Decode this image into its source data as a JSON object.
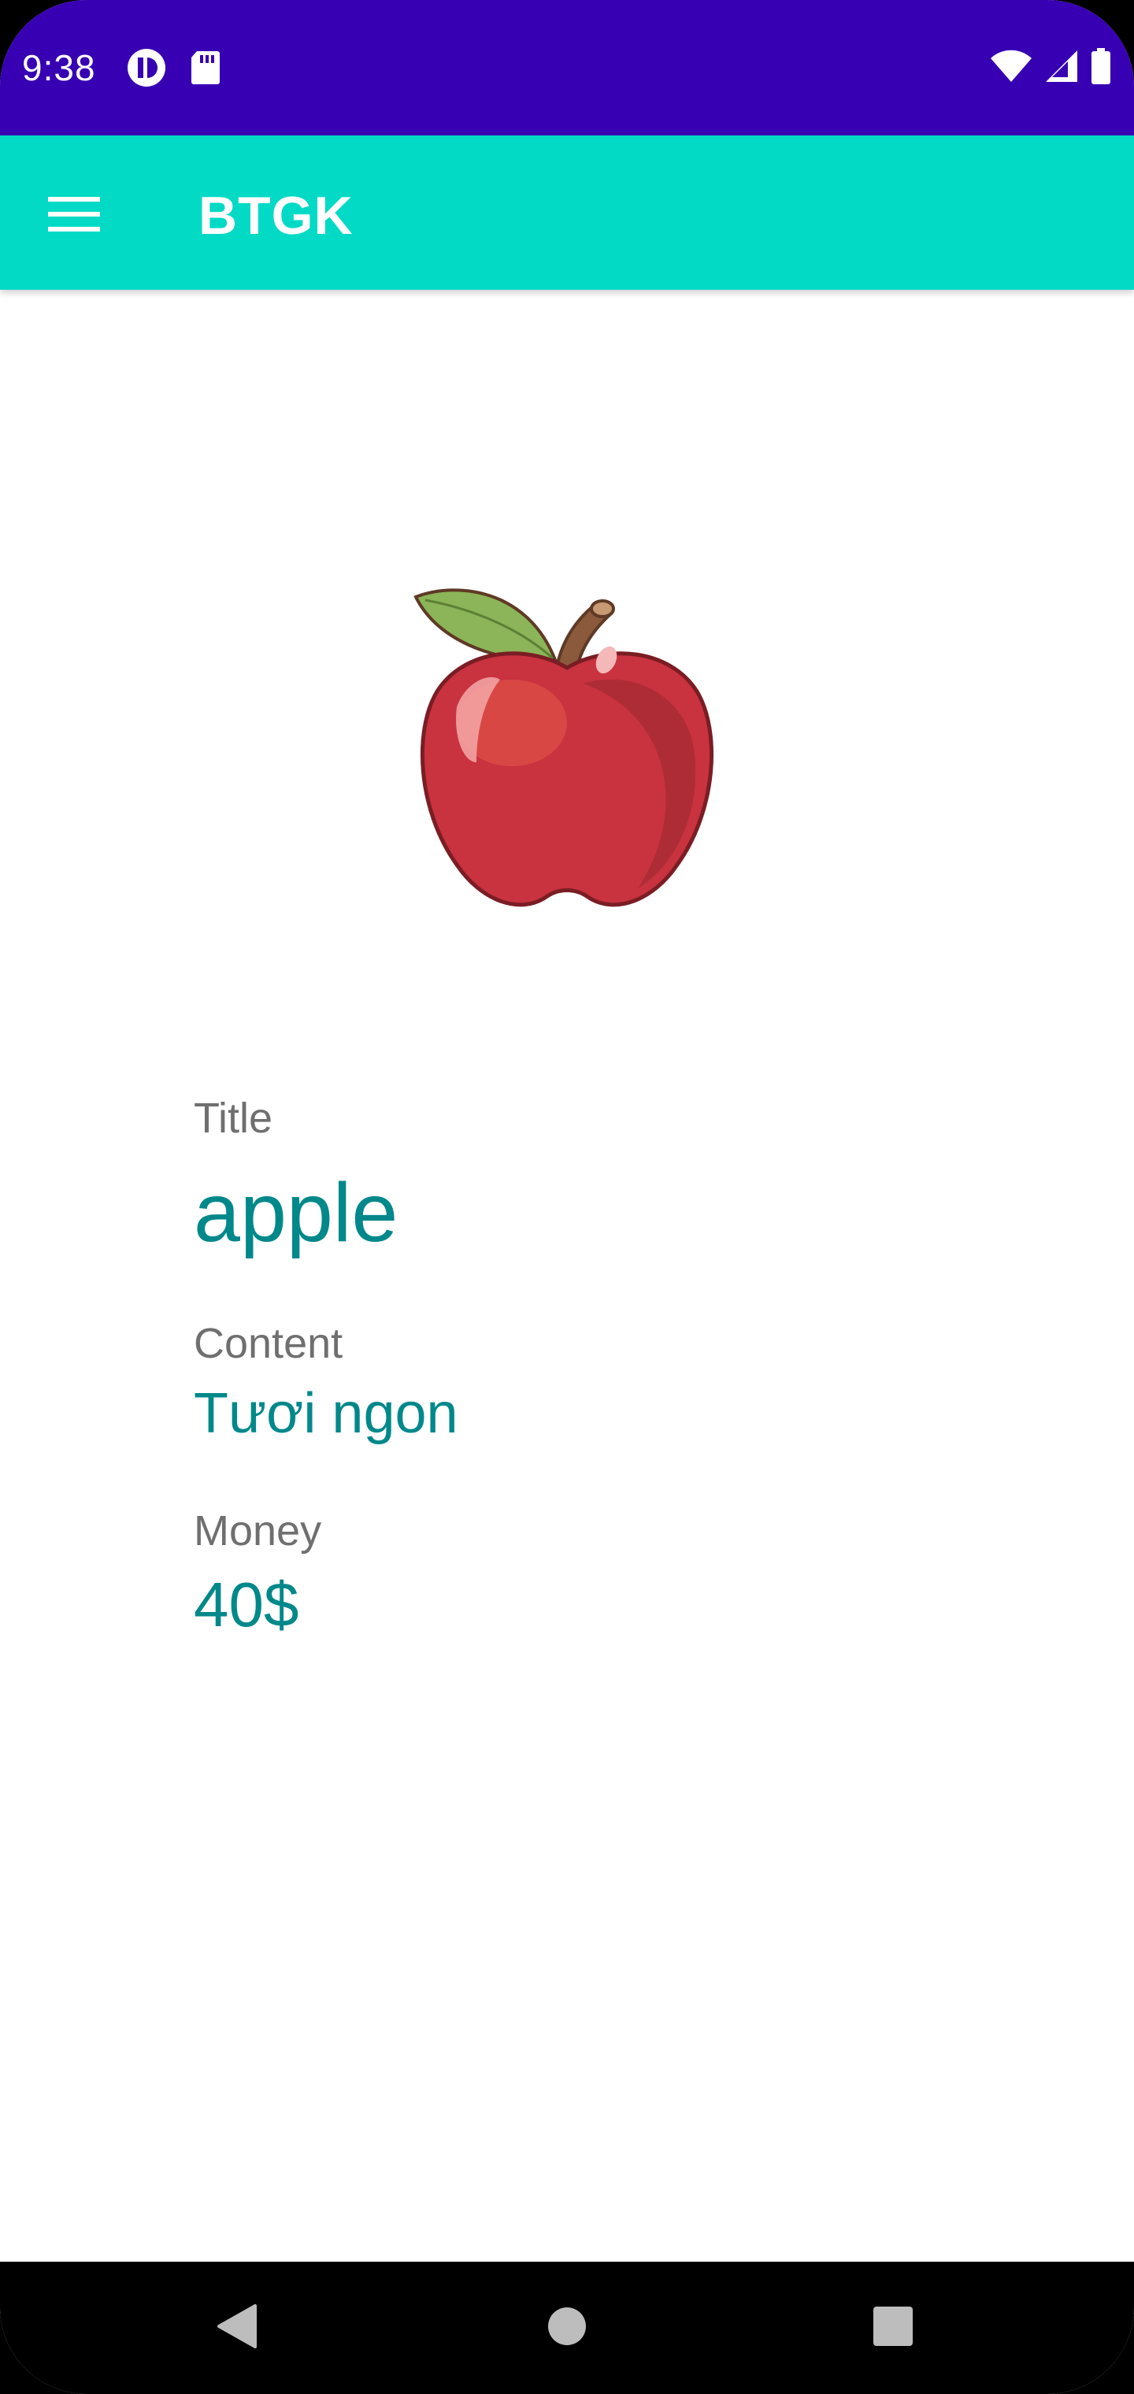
{
  "status_bar": {
    "time": "9:38",
    "background": "#3700b3",
    "left_icons": [
      "app-notification-icon",
      "sd-card-icon"
    ],
    "right_icons": [
      "wifi-icon",
      "cell-signal-icon",
      "battery-icon"
    ]
  },
  "app_bar": {
    "title": "BTGK",
    "background": "#03dac5",
    "menu_icon": "hamburger-menu-icon"
  },
  "detail": {
    "image": "apple-image",
    "title_label": "Title",
    "title_value": "apple",
    "content_label": "Content",
    "content_value": "Tươi ngon",
    "money_label": "Money",
    "money_value": "40$",
    "label_color": "#6f6f6f",
    "value_color": "#00888a"
  },
  "nav_bar": {
    "buttons": [
      "back-icon",
      "home-icon",
      "recents-icon"
    ]
  }
}
